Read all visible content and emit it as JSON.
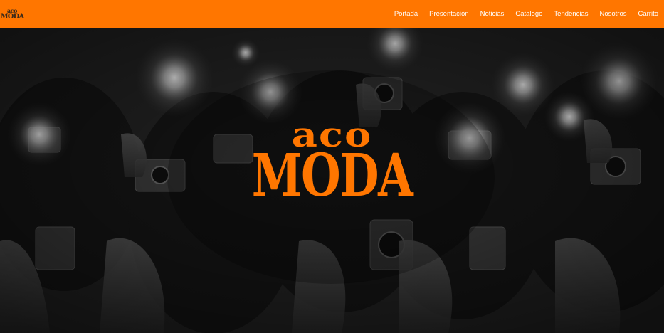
{
  "brand": {
    "logo_top": "aco",
    "logo_bottom": "MODA"
  },
  "nav": {
    "items": [
      {
        "label": "Portada"
      },
      {
        "label": "Presentación"
      },
      {
        "label": "Noticias"
      },
      {
        "label": "Catalogo"
      },
      {
        "label": "Tendencias"
      },
      {
        "label": "Nosotros"
      },
      {
        "label": "Carrito"
      }
    ]
  },
  "hero": {
    "logo_top": "aco",
    "logo_bottom": "MODA",
    "background_image": "photographers-with-cameras-flash"
  },
  "colors": {
    "accent": "#ff7600",
    "nav_text": "#ffffff",
    "hero_dark": "#1a1a1a"
  }
}
